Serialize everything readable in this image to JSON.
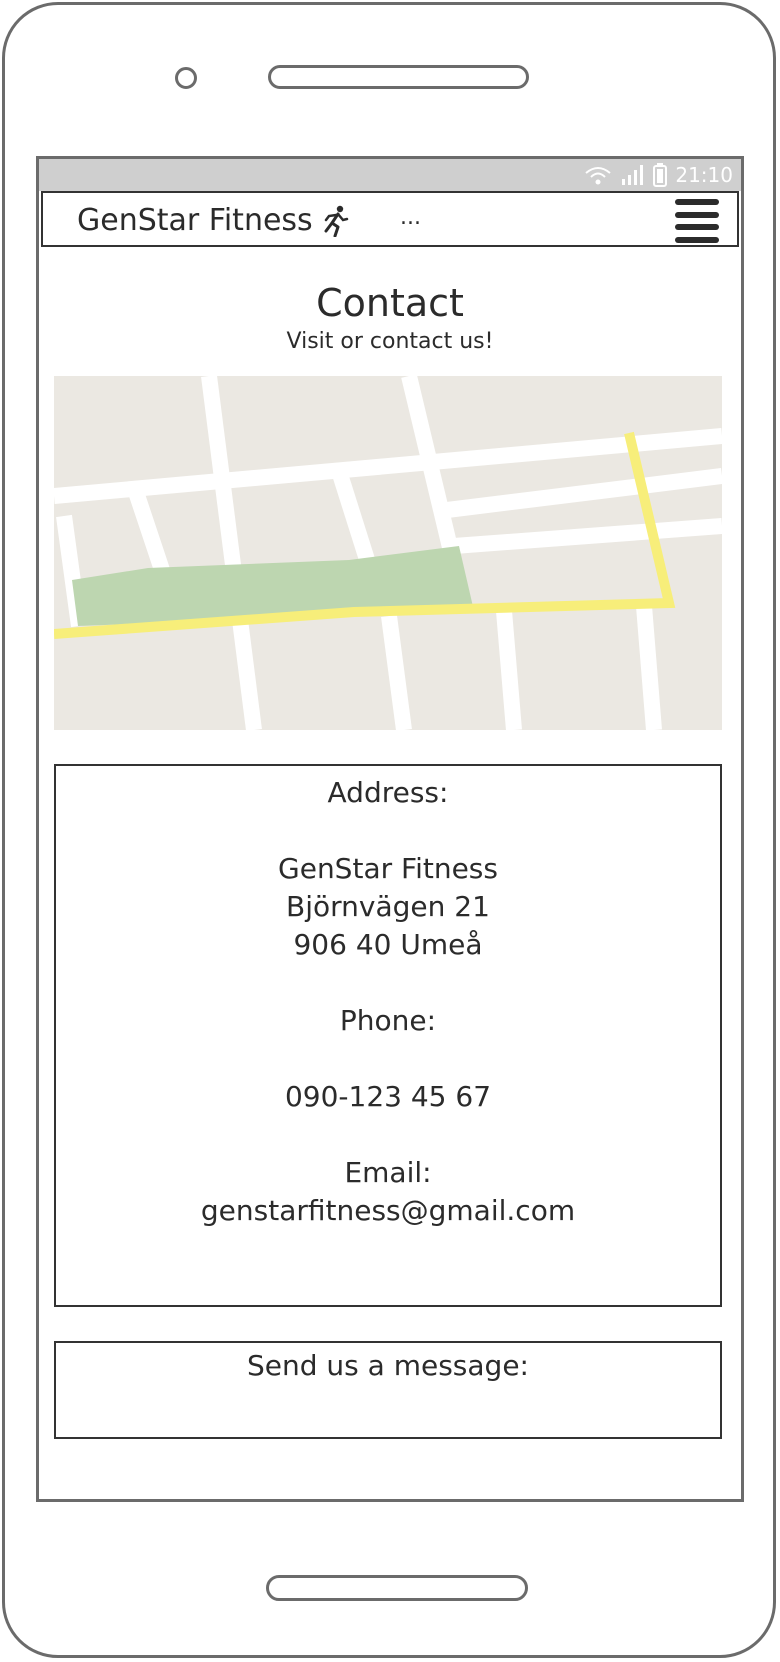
{
  "status_bar": {
    "time": "21:10"
  },
  "navbar": {
    "brand": "GenStar Fitness",
    "overflow": "..."
  },
  "page": {
    "title": "Contact",
    "subtitle": "Visit or contact us!"
  },
  "contact": {
    "address_label": "Address:",
    "address_name": "GenStar Fitness",
    "address_street": "Björnvägen 21",
    "address_city": "906 40 Umeå",
    "phone_label": "Phone:",
    "phone": "090-123 45 67",
    "email_label": "Email:",
    "email": "genstarfitness@gmail.com"
  },
  "message": {
    "label": "Send us a message:"
  },
  "icons": [
    "wifi-icon",
    "signal-icon",
    "battery-icon",
    "running-person-icon",
    "hamburger-menu-icon"
  ],
  "colors": {
    "map_background": "#ebe8e2",
    "map_park": "#bdd6b0",
    "map_highway": "#f7ee7a",
    "statusbar": "#cfcfcf"
  }
}
